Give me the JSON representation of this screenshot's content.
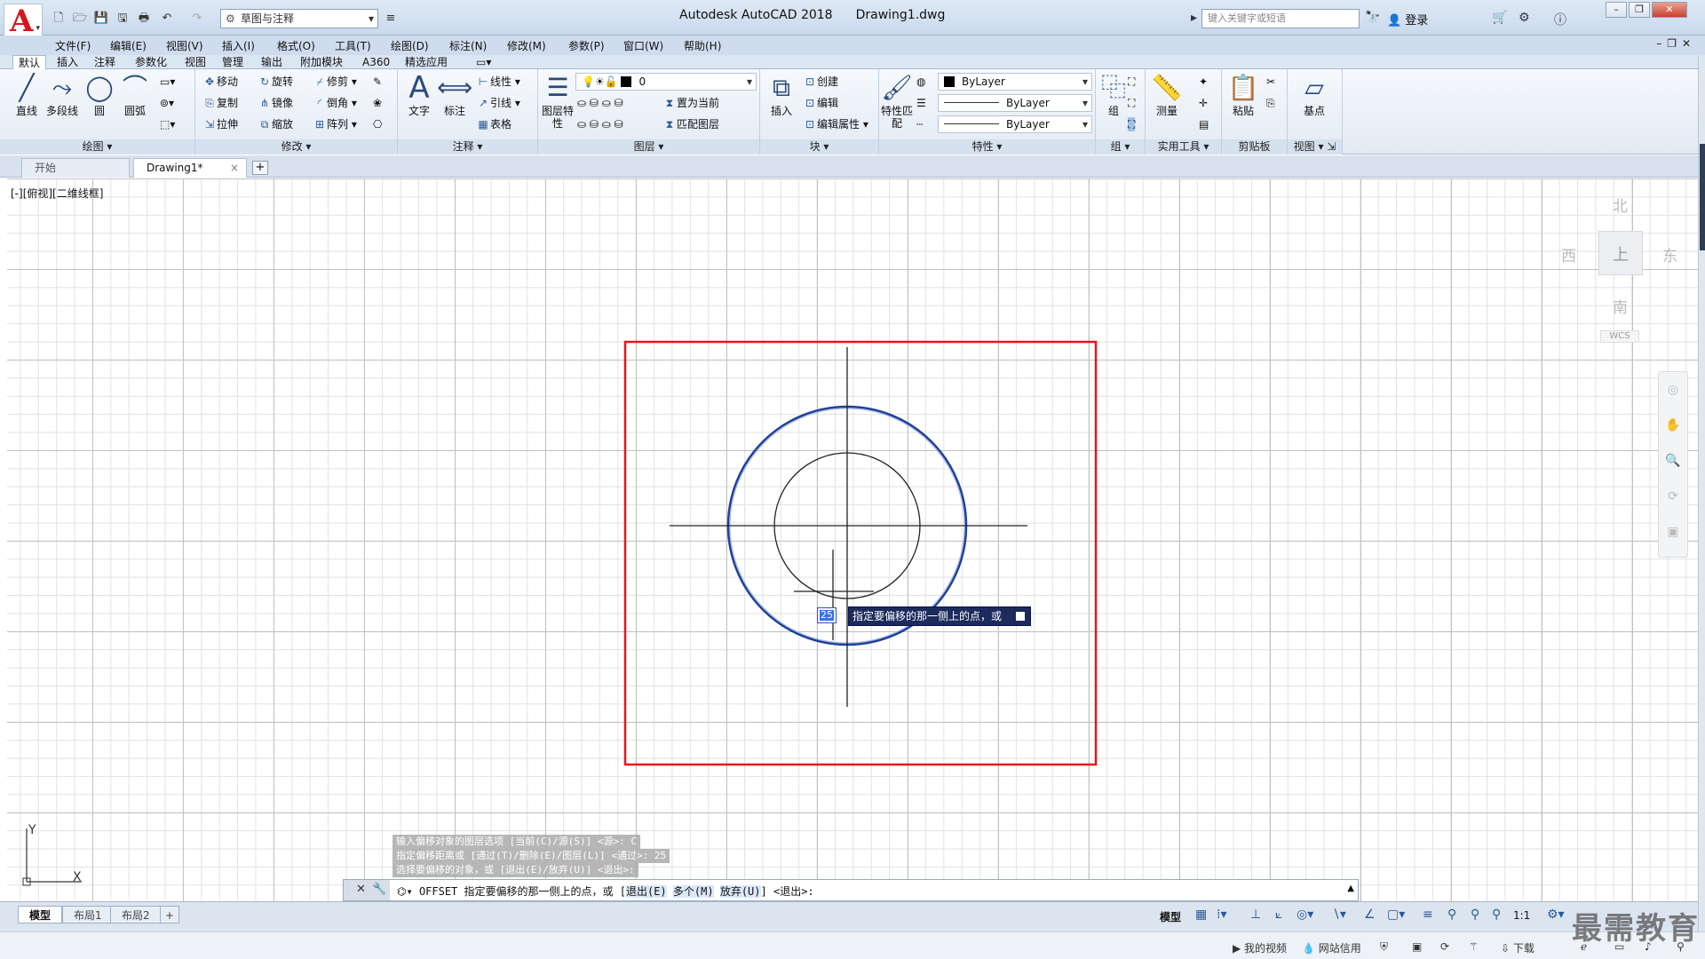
{
  "title_bar": {
    "workspace": "草图与注释",
    "app_title": "Autodesk AutoCAD 2018",
    "file_name": "Drawing1.dwg",
    "search_placeholder": "键入关键字或短语",
    "login": "登录"
  },
  "menu": [
    "文件(F)",
    "编辑(E)",
    "视图(V)",
    "插入(I)",
    "格式(O)",
    "工具(T)",
    "绘图(D)",
    "标注(N)",
    "修改(M)",
    "参数(P)",
    "窗口(W)",
    "帮助(H)"
  ],
  "ribbon_tabs": [
    "默认",
    "插入",
    "注释",
    "参数化",
    "视图",
    "管理",
    "输出",
    "附加模块",
    "A360",
    "精选应用"
  ],
  "panels": {
    "draw": {
      "title": "绘图",
      "line": "直线",
      "polyline": "多段线",
      "circle": "圆",
      "arc": "圆弧"
    },
    "modify": {
      "title": "修改",
      "move": "移动",
      "rotate": "旋转",
      "trim": "修剪",
      "copy": "复制",
      "mirror": "镜像",
      "fillet": "倒角",
      "stretch": "拉伸",
      "scale": "缩放",
      "array": "阵列"
    },
    "annotation": {
      "title": "注释",
      "text": "文字",
      "dimension": "标注",
      "linear": "线性",
      "leader": "引线",
      "table": "表格"
    },
    "layers": {
      "title": "图层",
      "layer_props": "图层特性",
      "layer_value": "0",
      "make_current": "置为当前",
      "match_layer": "匹配图层"
    },
    "block": {
      "title": "块",
      "insert": "插入",
      "create": "创建",
      "edit": "编辑",
      "edit_attr": "编辑属性"
    },
    "properties": {
      "title": "特性",
      "match": "特性匹配",
      "color": "ByLayer",
      "linetype": "ByLayer",
      "lineweight": "ByLayer"
    },
    "groups": {
      "title": "组",
      "group": "组"
    },
    "utilities": {
      "title": "实用工具",
      "measure": "测量"
    },
    "clipboard": {
      "title": "剪贴板",
      "paste": "粘贴"
    },
    "view": {
      "title": "视图",
      "base": "基点"
    }
  },
  "file_tabs": {
    "start": "开始",
    "drawing": "Drawing1*"
  },
  "viewport_label": "[-][俯视][二维线框]",
  "viewcube": {
    "north": "北",
    "south": "南",
    "east": "东",
    "west": "西",
    "wcs": "WCS"
  },
  "dynamic_input": {
    "value": "25",
    "prompt": "指定要偏移的那一侧上的点，或"
  },
  "command_history": [
    "输入偏移对象的图层选项 [当前(C)/源(S)] <源>:  C",
    "指定偏移距离或 [通过(T)/删除(E)/图层(L)] <通过>:  25",
    "选择要偏移的对象，或 [退出(E)/放弃(U)] <退出>:"
  ],
  "command_line": {
    "command": "OFFSET",
    "prompt": "指定要偏移的那一侧上的点，或 [",
    "opt1": "退出(E)",
    "opt2": "多个(M)",
    "opt3": "放弃(U)",
    "tail": "] <退出>:"
  },
  "layout_tabs": [
    "模型",
    "布局1",
    "布局2"
  ],
  "status": {
    "model": "模型",
    "scale": "1:1"
  },
  "ucs": {
    "x": "X",
    "y": "Y"
  },
  "bottom_strip": {
    "my_video": "我的视频",
    "web_credit": "网站信用",
    "download": "下载"
  },
  "watermark": "最需教育",
  "colors": {
    "accent": "#1c2a5c",
    "rect": "#e8141b",
    "circle_blue": "#1f3f9a",
    "logo": "#d8141b"
  }
}
